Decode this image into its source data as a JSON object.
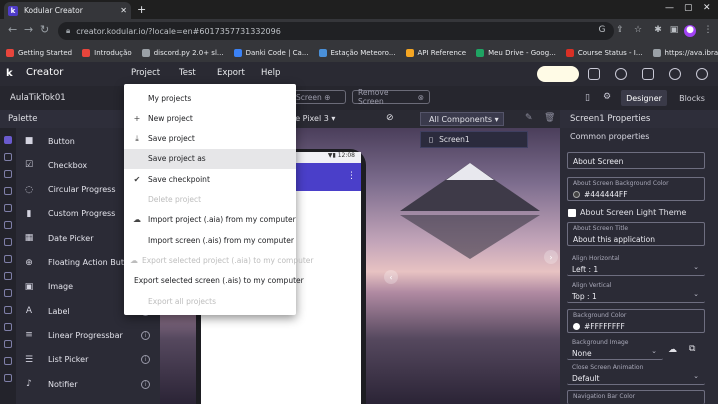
{
  "browser": {
    "tab_title": "Kodular Creator",
    "tab_close": "✕",
    "new_tab": "+",
    "url": "creator.kodular.io/?locale=en#6017357731332096",
    "bookmarks": [
      "Getting Started",
      "Introdução",
      "discord.py 2.0+ sl...",
      "Danki Code | Ca...",
      "Estação Meteoro...",
      "API Reference",
      "Meu Drive - Goog...",
      "Course Status - I...",
      "https://ava.ibrae..."
    ],
    "bookmark_colors": [
      "#e8453c",
      "#e8453c",
      "#9aa0a6",
      "#3b82f6",
      "#4a90d9",
      "#f5a623",
      "#1fa463",
      "#d93025",
      "#9aa0a6"
    ]
  },
  "app": {
    "logo": "k",
    "title": "Creator",
    "menu": [
      "Project",
      "Test",
      "Export",
      "Help"
    ],
    "project_name": "AulaTikTok01",
    "add_screen": "Screen",
    "remove_screen": "Remove Screen",
    "designer": "Designer",
    "blocks": "Blocks"
  },
  "palette": {
    "title": "Palette",
    "items": [
      {
        "label": "Button",
        "icon": "button-icon",
        "glyph": "■"
      },
      {
        "label": "Checkbox",
        "icon": "checkbox-icon",
        "glyph": "☑"
      },
      {
        "label": "Circular Progress",
        "icon": "circular-progress-icon",
        "glyph": "◌"
      },
      {
        "label": "Custom Progress",
        "icon": "custom-progress-icon",
        "glyph": "▮"
      },
      {
        "label": "Date Picker",
        "icon": "date-picker-icon",
        "glyph": "▦"
      },
      {
        "label": "Floating Action Button",
        "icon": "fab-icon",
        "glyph": "⊕"
      },
      {
        "label": "Image",
        "icon": "image-icon",
        "glyph": "▣"
      },
      {
        "label": "Label",
        "icon": "label-icon",
        "glyph": "A"
      },
      {
        "label": "Linear Progressbar",
        "icon": "linear-progressbar-icon",
        "glyph": "≡"
      },
      {
        "label": "List Picker",
        "icon": "list-picker-icon",
        "glyph": "☰"
      },
      {
        "label": "Notifier",
        "icon": "notifier-icon",
        "glyph": "♪"
      }
    ]
  },
  "viewer": {
    "device": "ogle Pixel 3",
    "all_components": "All Components",
    "screen_chip": "Screen1",
    "status_time": "12:08"
  },
  "properties": {
    "title": "Screen1 Properties",
    "section": "Common properties",
    "about_screen": "About Screen",
    "bg_color_caption": "About Screen Background Color",
    "bg_color_value": "#444444FF",
    "light_theme_label": "About Screen Light Theme",
    "title_caption": "About Screen Title",
    "title_value": "About this application",
    "align_h_caption": "Align Horizontal",
    "align_h_value": "Left : 1",
    "align_v_caption": "Align Vertical",
    "align_v_value": "Top : 1",
    "bgcolor_caption": "Background Color",
    "bgcolor_value": "#FFFFFFFF",
    "bgimage_caption": "Background Image",
    "bgimage_value": "None",
    "anim_caption": "Close Screen Animation",
    "anim_value": "Default",
    "navbar_caption": "Navigation Bar Color"
  },
  "project_menu": [
    {
      "label": "My projects",
      "icon": "",
      "disabled": false
    },
    {
      "label": "New project",
      "icon": "+",
      "disabled": false
    },
    {
      "label": "Save project",
      "icon": "⤓",
      "disabled": false
    },
    {
      "label": "Save project as",
      "icon": "",
      "disabled": false,
      "highlight": true
    },
    {
      "label": "Save checkpoint",
      "icon": "✔",
      "disabled": false
    },
    {
      "label": "Delete project",
      "icon": "",
      "disabled": true
    },
    {
      "label": "Import project (.aia) from my computer",
      "icon": "☁",
      "disabled": false
    },
    {
      "label": "Import screen (.ais) from my computer",
      "icon": "",
      "disabled": false
    },
    {
      "label": "Export selected project (.aia) to my computer",
      "icon": "☁",
      "disabled": true
    },
    {
      "label": "Export selected screen (.ais) to my computer",
      "icon": "",
      "disabled": false
    },
    {
      "label": "Export all projects",
      "icon": "",
      "disabled": true
    }
  ]
}
